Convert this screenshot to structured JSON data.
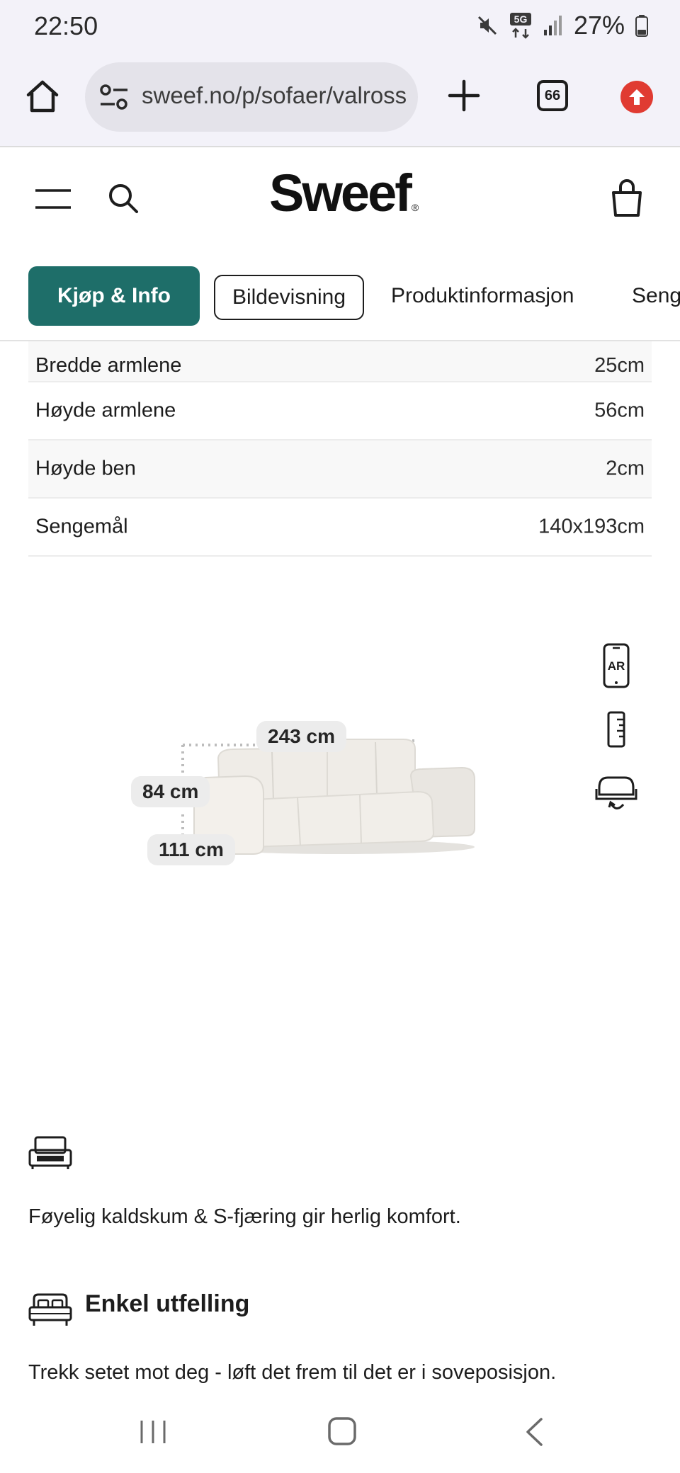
{
  "status_bar": {
    "time": "22:50",
    "battery_percent": "27%",
    "network_label": "5G",
    "icons": [
      "mute-icon",
      "5g-icon",
      "signal-icon",
      "battery-icon"
    ]
  },
  "browser": {
    "url": "sweef.no/p/sofaer/valross",
    "tab_count": "66",
    "icons": [
      "home-icon",
      "site-settings-icon",
      "plus-icon",
      "tabs-icon",
      "update-icon"
    ]
  },
  "header": {
    "logo": "Sweef",
    "logo_mark": "®",
    "icons": [
      "menu-icon",
      "search-icon",
      "bag-icon"
    ]
  },
  "sub_nav": {
    "tabs": [
      {
        "label": "Kjøp & Info",
        "state": "active"
      },
      {
        "label": "Bildevisning",
        "state": "outlined"
      },
      {
        "label": "Produktinformasjon",
        "state": "plain"
      },
      {
        "label": "Seng",
        "state": "plain"
      }
    ]
  },
  "specs": [
    {
      "label": "Bredde armlene",
      "value": "25cm"
    },
    {
      "label": "Høyde armlene",
      "value": "56cm"
    },
    {
      "label": "Høyde ben",
      "value": "2cm"
    },
    {
      "label": "Sengemål",
      "value": "140x193cm"
    }
  ],
  "viewer": {
    "width_label": "243 cm",
    "height_label": "84 cm",
    "depth_label": "111 cm",
    "tools": {
      "ar_label": "AR",
      "icons": [
        "ar-icon",
        "ruler-icon",
        "rotate-icon"
      ]
    }
  },
  "features": {
    "item1_text": "Føyelig kaldskum & S-fjæring gir herlig komfort.",
    "item2_title": "Enkel utfelling",
    "item2_text": "Trekk setet mot deg - løft det frem til det er i soveposisjon."
  },
  "colors": {
    "accent": "#1e6e69",
    "status_bg": "#f3f2f9",
    "update_red": "#e03b32",
    "sofa": "#eeebe6"
  }
}
